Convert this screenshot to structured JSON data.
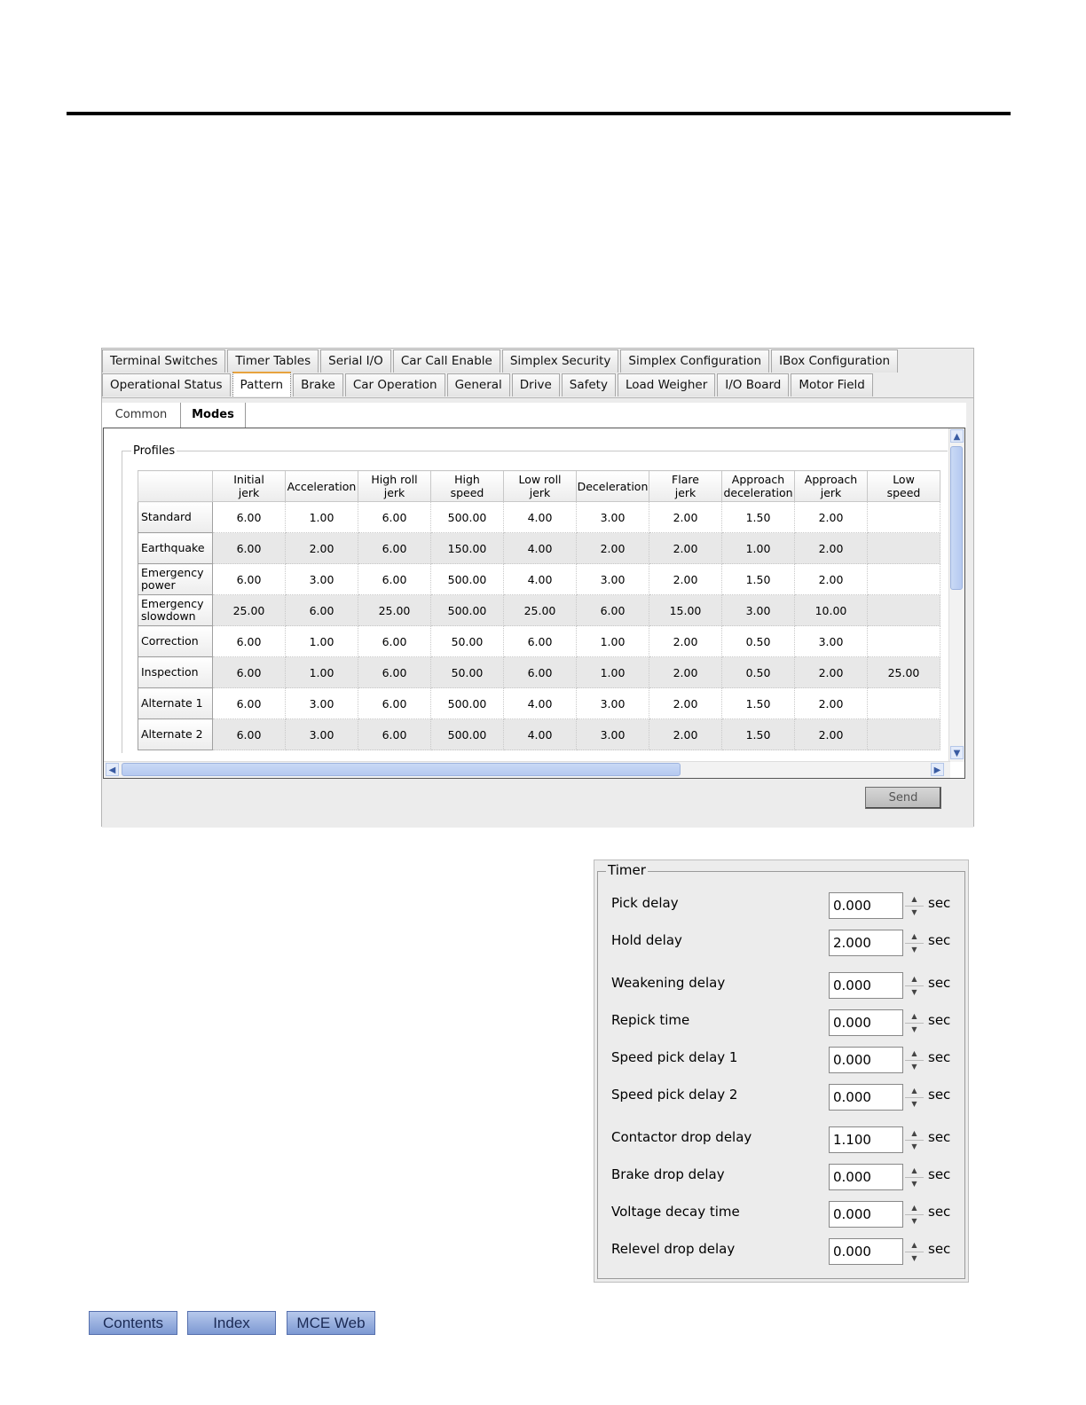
{
  "tabs_row1": [
    "Terminal Switches",
    "Timer Tables",
    "Serial I/O",
    "Car Call Enable",
    "Simplex Security",
    "Simplex Configuration",
    "IBox Configuration"
  ],
  "tabs_row2": [
    "Operational Status",
    "Pattern",
    "Brake",
    "Car Operation",
    "General",
    "Drive",
    "Safety",
    "Load Weigher",
    "I/O Board",
    "Motor Field"
  ],
  "active_tab": "Pattern",
  "subtabs": {
    "common": "Common",
    "modes": "Modes"
  },
  "profiles": {
    "legend": "Profiles",
    "columns": [
      [
        "Initial",
        "jerk"
      ],
      [
        "Acceleration",
        ""
      ],
      [
        "High roll",
        "jerk"
      ],
      [
        "High",
        "speed"
      ],
      [
        "Low roll",
        "jerk"
      ],
      [
        "Deceleration",
        ""
      ],
      [
        "Flare",
        "jerk"
      ],
      [
        "Approach",
        "deceleration"
      ],
      [
        "Approach",
        "jerk"
      ],
      [
        "Low",
        "speed"
      ]
    ],
    "rows": [
      {
        "name": [
          "Standard"
        ],
        "values": [
          "6.00",
          "1.00",
          "6.00",
          "500.00",
          "4.00",
          "3.00",
          "2.00",
          "1.50",
          "2.00",
          ""
        ]
      },
      {
        "name": [
          "Earthquake"
        ],
        "values": [
          "6.00",
          "2.00",
          "6.00",
          "150.00",
          "4.00",
          "2.00",
          "2.00",
          "1.00",
          "2.00",
          ""
        ]
      },
      {
        "name": [
          "Emergency",
          "power"
        ],
        "values": [
          "6.00",
          "3.00",
          "6.00",
          "500.00",
          "4.00",
          "3.00",
          "2.00",
          "1.50",
          "2.00",
          ""
        ]
      },
      {
        "name": [
          "Emergency",
          "slowdown"
        ],
        "values": [
          "25.00",
          "6.00",
          "25.00",
          "500.00",
          "25.00",
          "6.00",
          "15.00",
          "3.00",
          "10.00",
          ""
        ]
      },
      {
        "name": [
          "Correction"
        ],
        "values": [
          "6.00",
          "1.00",
          "6.00",
          "50.00",
          "6.00",
          "1.00",
          "2.00",
          "0.50",
          "3.00",
          ""
        ]
      },
      {
        "name": [
          "Inspection"
        ],
        "values": [
          "6.00",
          "1.00",
          "6.00",
          "50.00",
          "6.00",
          "1.00",
          "2.00",
          "0.50",
          "2.00",
          "25.00"
        ]
      },
      {
        "name": [
          "Alternate 1"
        ],
        "values": [
          "6.00",
          "3.00",
          "6.00",
          "500.00",
          "4.00",
          "3.00",
          "2.00",
          "1.50",
          "2.00",
          ""
        ]
      },
      {
        "name": [
          "Alternate 2"
        ],
        "values": [
          "6.00",
          "3.00",
          "6.00",
          "500.00",
          "4.00",
          "3.00",
          "2.00",
          "1.50",
          "2.00",
          ""
        ]
      }
    ]
  },
  "send_label": "Send",
  "timer": {
    "legend": "Timer",
    "unit": "sec",
    "rows": [
      {
        "label": "Pick delay",
        "value": "0.000"
      },
      {
        "label": "Hold delay",
        "value": "2.000"
      },
      {
        "label": "Weakening delay",
        "value": "0.000"
      },
      {
        "label": "Repick time",
        "value": "0.000"
      },
      {
        "label": "Speed pick delay 1",
        "value": "0.000"
      },
      {
        "label": "Speed pick delay 2",
        "value": "0.000"
      },
      {
        "label": "Contactor drop delay",
        "value": "1.100"
      },
      {
        "label": "Brake drop delay",
        "value": "0.000"
      },
      {
        "label": "Voltage decay time",
        "value": "0.000"
      },
      {
        "label": "Relevel drop delay",
        "value": "0.000"
      }
    ]
  },
  "nav": {
    "contents": "Contents",
    "index": "Index",
    "mce_web": "MCE Web"
  },
  "icons": {
    "scroll_up": "scroll-up-arrow-icon",
    "scroll_down": "scroll-down-arrow-icon",
    "scroll_left": "scroll-left-arrow-icon",
    "scroll_right": "scroll-right-arrow-icon",
    "spin_up": "spin-up-icon",
    "spin_down": "spin-down-icon"
  }
}
